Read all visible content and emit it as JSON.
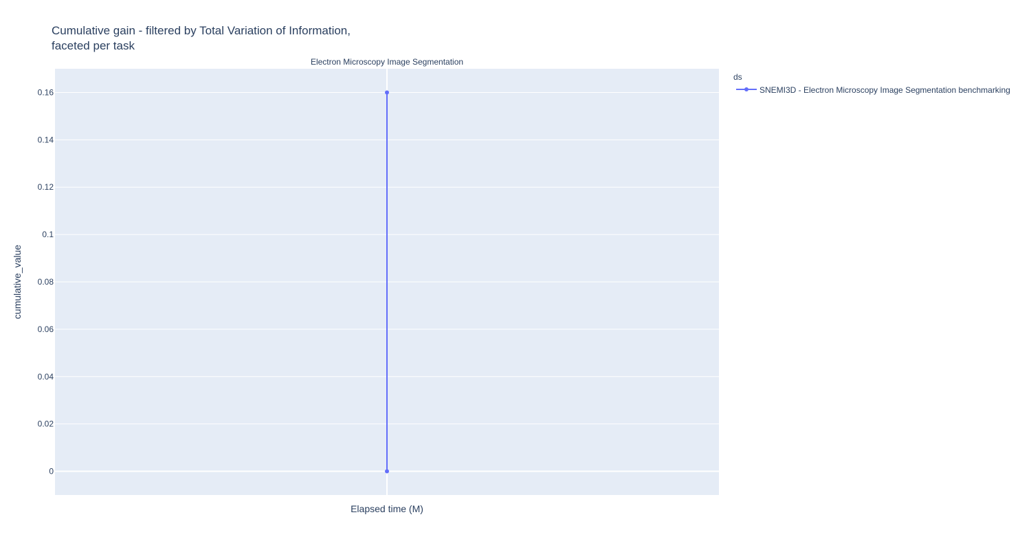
{
  "chart_data": {
    "type": "line",
    "title_lines": [
      "Cumulative gain - filtered by Total Variation of Information,",
      "faceted per task"
    ],
    "subplot_title": "Electron Microscopy Image Segmentation",
    "xlabel": "Elapsed time (M)",
    "ylabel": "cumulative_value",
    "ylim": [
      -0.01,
      0.17
    ],
    "yticks": [
      0,
      0.02,
      0.04,
      0.06,
      0.08,
      0.1,
      0.12,
      0.14,
      0.16
    ],
    "ytick_labels": [
      "0",
      "0.02",
      "0.04",
      "0.06",
      "0.08",
      "0.1",
      "0.12",
      "0.14",
      "0.16"
    ],
    "grid": true,
    "legend": {
      "title": "ds",
      "placement": "right"
    },
    "series": [
      {
        "name": "SNEMI3D - Electron Microscopy Image Segmentation benchmarking",
        "color": "#636efa",
        "y": [
          0,
          0.16
        ]
      }
    ]
  },
  "colors": {
    "plot_background": "#e5ecf6",
    "gridline": "#ffffff",
    "text": "#2a3f5f"
  }
}
